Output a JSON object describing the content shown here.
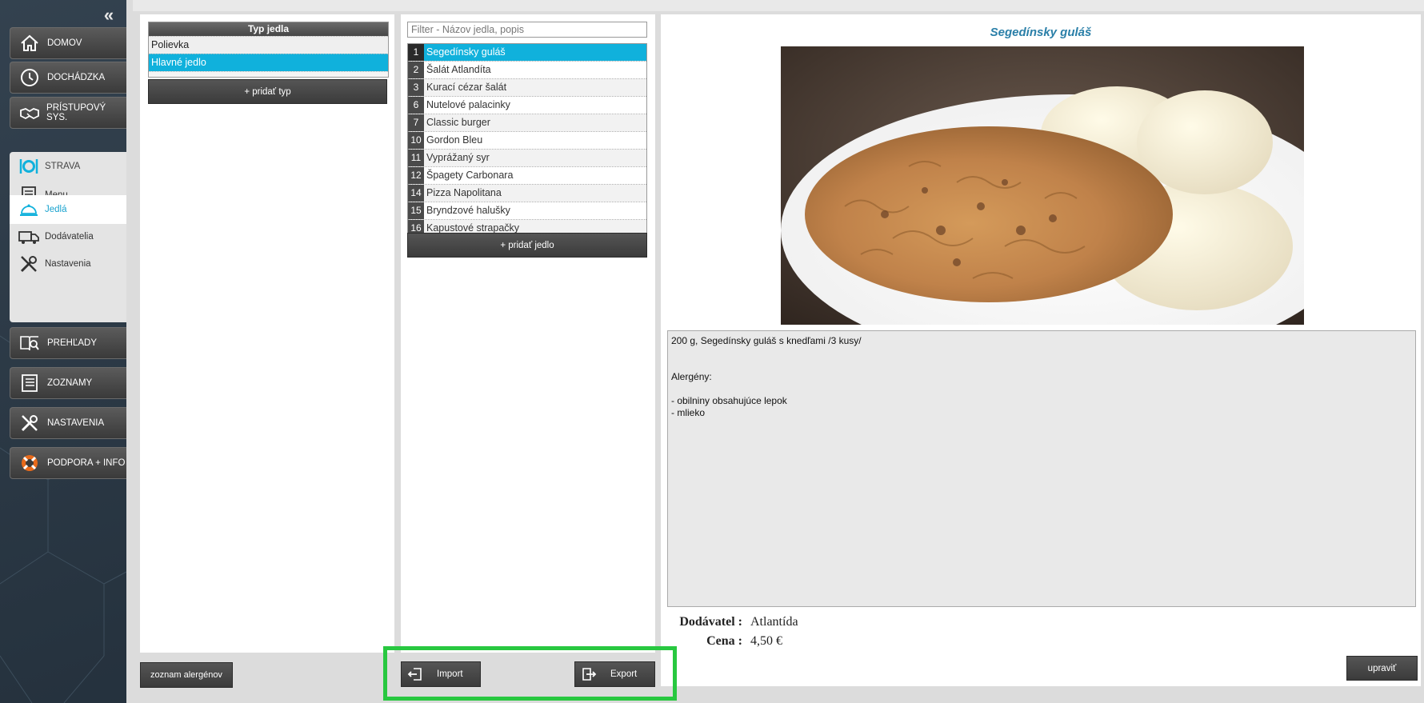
{
  "sidebar": {
    "collapse_glyph": "«",
    "nav": [
      {
        "label": "DOMOV",
        "icon": "home-icon"
      },
      {
        "label": "DOCHÁDZKA",
        "icon": "clock-icon"
      },
      {
        "label": "PRÍSTUPOVÝ SYS.",
        "icon": "handshake-icon"
      }
    ],
    "strava": {
      "label": "STRAVA",
      "icon": "plate-cutlery-icon",
      "items": [
        {
          "label": "Menu",
          "icon": "document-icon"
        },
        {
          "label": "Jedlá",
          "icon": "cloche-icon",
          "active": true
        },
        {
          "label": "Dodávatelia",
          "icon": "truck-icon"
        },
        {
          "label": "Nastavenia",
          "icon": "tools-icon"
        }
      ]
    },
    "nav_bottom": [
      {
        "label": "PREHĽADY",
        "icon": "book-magnifier-icon"
      },
      {
        "label": "ZOZNAMY",
        "icon": "list-icon"
      },
      {
        "label": "NASTAVENIA",
        "icon": "tools-icon"
      },
      {
        "label": "PODPORA + INFO",
        "icon": "lifebuoy-icon"
      }
    ]
  },
  "types": {
    "header": "Typ jedla",
    "rows": [
      "Polievka",
      "Hlavné jedlo"
    ],
    "selected": 1,
    "add_label": "+ pridať typ"
  },
  "dishes": {
    "filter_placeholder": "Filter - Názov jedla, popis",
    "rows": [
      {
        "num": "1",
        "name": "Segedínsky guláš"
      },
      {
        "num": "2",
        "name": "Šalát Atlandíta"
      },
      {
        "num": "3",
        "name": "Kurací cézar šalát"
      },
      {
        "num": "6",
        "name": "Nutelové palacinky"
      },
      {
        "num": "7",
        "name": "Classic burger"
      },
      {
        "num": "10",
        "name": "Gordon Bleu"
      },
      {
        "num": "11",
        "name": "Vyprážaný syr"
      },
      {
        "num": "12",
        "name": "Špagety Carbonara"
      },
      {
        "num": "14",
        "name": "Pizza Napolitana"
      },
      {
        "num": "15",
        "name": "Bryndzové halušky"
      },
      {
        "num": "16",
        "name": "Kapustové strapačky"
      }
    ],
    "selected": 0,
    "add_label": "+ pridať jedlo"
  },
  "detail": {
    "title": "Segedínsky guláš",
    "description": "200 g, Segedínsky guláš s knedľami /3 kusy/\n\n\nAlergény:\n\n- obilniny obsahujúce lepok\n- mlieko",
    "supplier_label": "Dodávatel :",
    "supplier_value": "Atlantída",
    "price_label": "Cena :",
    "price_value": "4,50 €",
    "edit_label": "upraviť"
  },
  "actions": {
    "allergen_list_label": "zoznam alergénov",
    "import_label": "Import",
    "export_label": "Export",
    "highlight_color": "#28c840"
  },
  "colors": {
    "accent": "#10b1dc",
    "sidebar_bg": "#2b3a48",
    "title_blue": "#2a7fa8"
  }
}
